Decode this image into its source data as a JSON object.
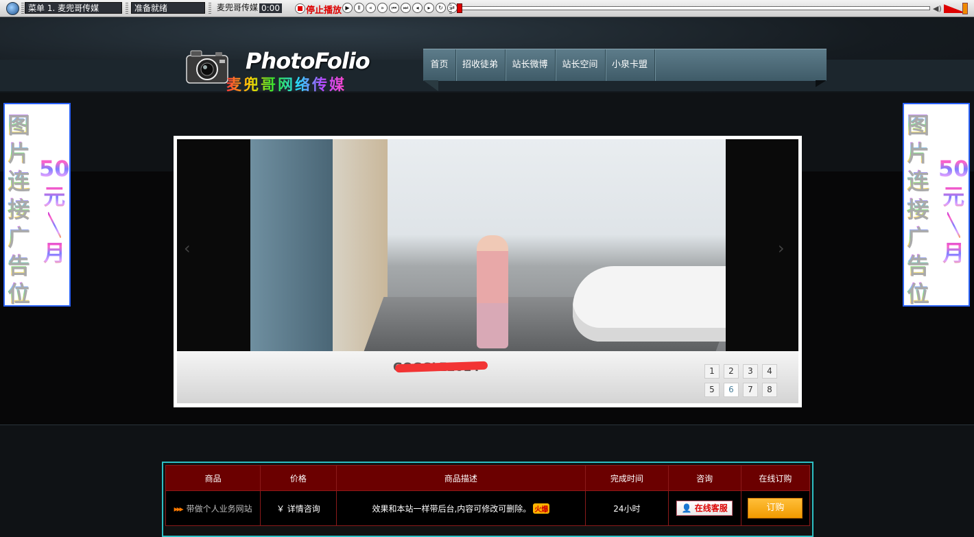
{
  "player": {
    "menu_label": "菜单 1. 麦兜哥传媒",
    "status": "准备就绪",
    "track_name": "麦兜哥传媒",
    "time": "0:00",
    "stop_label": "停止播放",
    "buttons": [
      "play-icon",
      "pause-icon",
      "prev-icon",
      "next-icon",
      "first-icon",
      "last-icon",
      "rewind-icon",
      "forward-icon",
      "loop-icon",
      "random-icon"
    ],
    "progress": 0,
    "volume": 0.8
  },
  "brand": {
    "name_en": "PhotoFolio",
    "name_cn": "麦兜哥网络传媒"
  },
  "nav": {
    "items": [
      {
        "label": "首页"
      },
      {
        "label": "招收徒弟"
      },
      {
        "label": "站长微博"
      },
      {
        "label": "站长空间"
      },
      {
        "label": "小泉卡盟"
      }
    ]
  },
  "side_ad": {
    "col1": [
      "图",
      "片",
      "连",
      "接",
      "广",
      "告",
      "位"
    ],
    "col2": [
      "50",
      "元",
      "╲",
      "月"
    ]
  },
  "slider": {
    "caption": "GOGGLE2014",
    "prev_arrow": "‹",
    "next_arrow": "›",
    "pages": [
      "1",
      "2",
      "3",
      "4",
      "5",
      "6",
      "7",
      "8"
    ],
    "active_page": 6
  },
  "table": {
    "headers": [
      "商品",
      "价格",
      "商品描述",
      "完成时间",
      "咨询",
      "在线订购"
    ],
    "rows": [
      {
        "product": "带做个人业务网站",
        "price": "￥ 详情咨询",
        "description": "效果和本站一样带后台,内容可修改可删除。",
        "hot_badge": "火爆",
        "time": "24小时",
        "consult": "在线客服",
        "order": "订购"
      }
    ]
  },
  "colors": {
    "accent": "#2dbfc4",
    "table_header": "#6b0000",
    "order_button": "#f09a00",
    "nav": "#4f6c79"
  }
}
